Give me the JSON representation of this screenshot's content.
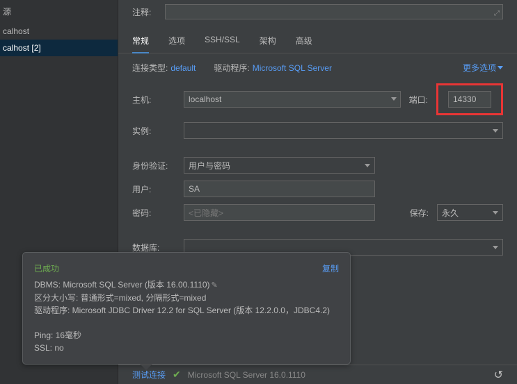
{
  "sidebar": {
    "header": "源",
    "items": [
      {
        "label": "calhost"
      },
      {
        "label": "calhost [2]"
      }
    ]
  },
  "comment_row": {
    "label": "注释:"
  },
  "tabs": [
    {
      "label": "常规",
      "active": true
    },
    {
      "label": "选项"
    },
    {
      "label": "SSH/SSL"
    },
    {
      "label": "架构"
    },
    {
      "label": "高级"
    }
  ],
  "top_row": {
    "conn_type_label": "连接类型:",
    "conn_type_value": "default",
    "driver_label": "驱动程序:",
    "driver_value": "Microsoft SQL Server",
    "more_options": "更多选项"
  },
  "form": {
    "host_label": "主机:",
    "host_value": "localhost",
    "port_label": "端口:",
    "port_value": "14330",
    "instance_label": "实例:",
    "auth_label": "身份验证:",
    "auth_value": "用户与密码",
    "user_label": "用户:",
    "user_value": "SA",
    "password_label": "密码:",
    "password_placeholder": "<已隐藏>",
    "save_label": "保存:",
    "save_value": "永久",
    "database_label": "数据库:"
  },
  "popup": {
    "title": "已成功",
    "copy": "复制",
    "line1_prefix": "DBMS: ",
    "line1_value": "Microsoft SQL Server (版本 16.00.1110)",
    "line2": "区分大小写: 普通形式=mixed, 分隔形式=mixed",
    "line3": "驱动程序: Microsoft JDBC Driver 12.2 for SQL Server (版本 12.2.0.0，JDBC4.2)",
    "line4": "Ping: 16毫秒",
    "line5": "SSL: no"
  },
  "bottom": {
    "test_conn": "测试连接",
    "status": "Microsoft SQL Server 16.0.1110"
  }
}
